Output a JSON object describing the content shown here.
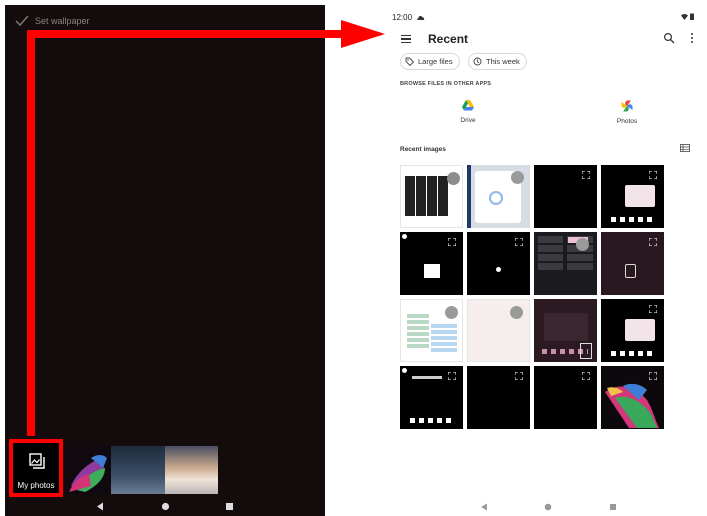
{
  "left_screen": {
    "header_label": "Set wallpaper",
    "my_photos_label": "My photos",
    "icons": [
      "check-icon",
      "photo-gallery-icon",
      "back-icon",
      "home-icon",
      "recents-icon"
    ]
  },
  "right_screen": {
    "status_time": "12:00",
    "title": "Recent",
    "chips": [
      {
        "label": "Large files",
        "icon": "tag-icon"
      },
      {
        "label": "This week",
        "icon": "history-icon"
      }
    ],
    "browse_heading": "BROWSE FILES IN OTHER APPS",
    "apps": [
      {
        "label": "Drive",
        "icon": "drive-icon"
      },
      {
        "label": "Photos",
        "icon": "photos-pinwheel-icon"
      }
    ],
    "recent_images_heading": "Recent images",
    "icons": [
      "menu-icon",
      "search-icon",
      "more-vert-icon",
      "list-view-icon",
      "expand-icon"
    ]
  },
  "annotation": {
    "color": "#ff0000"
  }
}
